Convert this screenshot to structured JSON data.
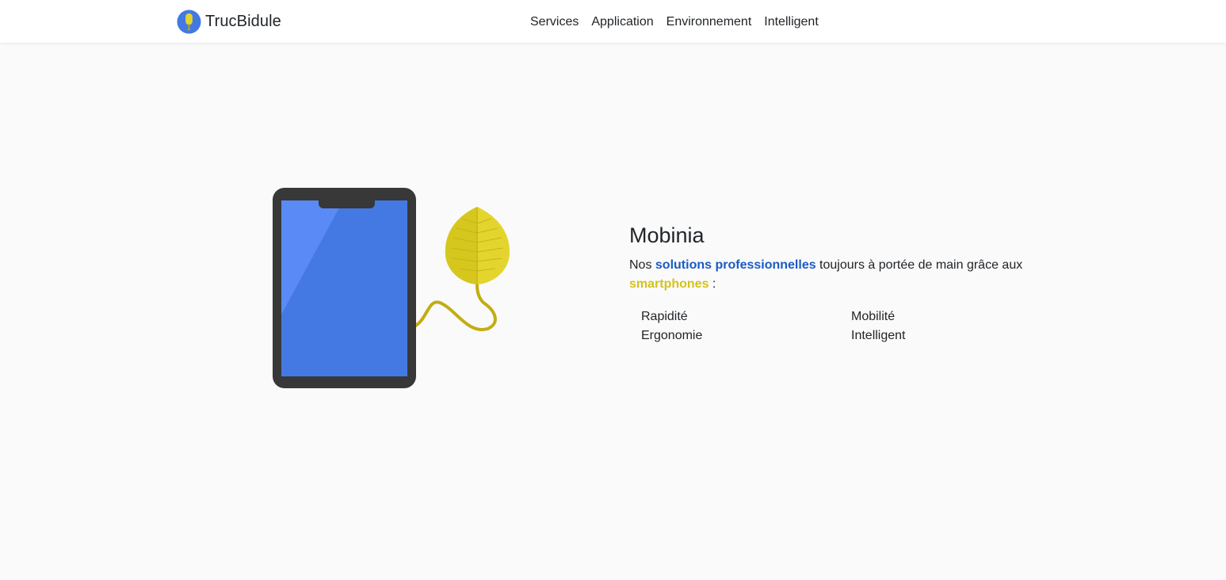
{
  "header": {
    "brand_name": "TrucBidule",
    "brand_icon": "bulb-logo-icon",
    "nav": [
      "Services",
      "Application",
      "Environnement",
      "Intelligent"
    ]
  },
  "hero": {
    "title": "Mobinia",
    "lead_prefix": "Nos ",
    "lead_highlight_1": "solutions professionnelles",
    "lead_middle": " toujours à portée de main grâce aux ",
    "lead_highlight_2": "smartphones",
    "lead_suffix": " :",
    "features": [
      "Rapidité",
      "Mobilité",
      "Ergonomie",
      "Intelligent"
    ],
    "illustration": "phone-with-leaf-plug-icon"
  },
  "colors": {
    "accent_blue": "#1a5bc4",
    "accent_yellow": "#d4c21e",
    "phone_screen": "#4479e4",
    "phone_frame": "#383838",
    "leaf": "#e3d52e",
    "background": "#fafafa"
  }
}
